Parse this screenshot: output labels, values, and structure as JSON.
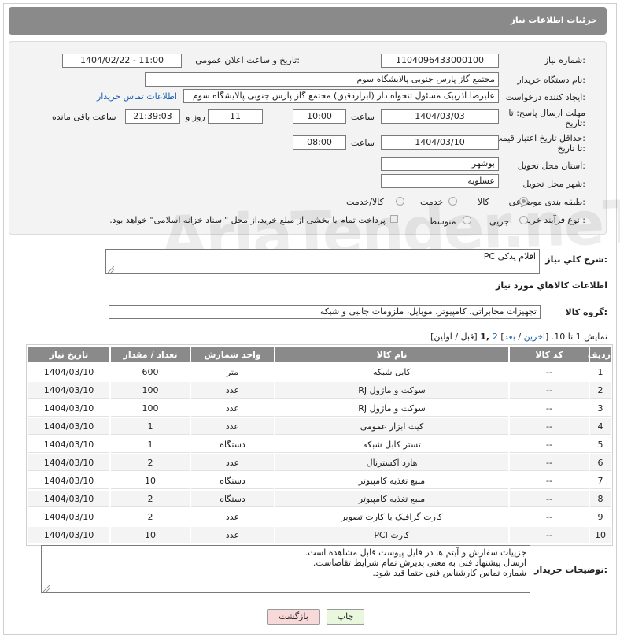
{
  "header": {
    "title": "جزئیات اطلاعات نیاز"
  },
  "watermark": "AriaTender.neT",
  "form": {
    "need_number_label": "شماره نیاز:",
    "need_number": "1104096433000100",
    "announce_label": "تاریخ و ساعت اعلان عمومی:",
    "announce_value": "1404/02/22 - 11:00",
    "buyer_org_label": "نام دستگاه خریدار:",
    "buyer_org": "مجتمع گاز پارس جنوبی  پالایشگاه سوم",
    "requester_label": "ایجاد کننده درخواست:",
    "requester": "علیرضا آذربیک مسئول تنخواه دار  (ابزاردقیق) مجتمع گاز پارس جنوبی  پالایشگاه سوم",
    "buyer_contact_link": "اطلاعات تماس خریدار",
    "deadline_label_1": "مهلت ارسال پاسخ: تا",
    "deadline_label_2": "تاریخ:",
    "deadline_date": "1404/03/03",
    "time_label": "ساعت",
    "deadline_time": "10:00",
    "days_value": "11",
    "days_label": "روز و",
    "remaining_time": "21:39:03",
    "remaining_label": "ساعت باقی مانده",
    "price_validity_label_1": "حداقل تاریخ اعتبار قیمت:",
    "price_validity_label_2": "تا تاریخ:",
    "price_validity_date": "1404/03/10",
    "price_validity_time": "08:00",
    "province_label": "استان محل تحویل:",
    "province": "بوشهر",
    "city_label": "شهر محل تحویل:",
    "city": "عسلویه",
    "category_label": "طبقه بندی موضوعی:",
    "category_options": [
      "کالا",
      "خدمت",
      "کالا/خدمت"
    ],
    "category_selected": "کالا",
    "process_label": "نوع فرآیند خرید :",
    "process_options": [
      "جزیی",
      "متوسط"
    ],
    "payment_note": "پرداخت تمام یا بخشی از مبلغ خرید،از محل \"اسناد خزانه اسلامی\" خواهد بود."
  },
  "summary": {
    "label": "شرح كلي نياز:",
    "value": "اقلام یدکی PC"
  },
  "goods_section": {
    "title": "اطلاعات كالاهاي مورد نياز",
    "group_label": "گروه كالا:",
    "group_value": "تجهیزات مخابراتی، کامپیوتر، موبایل، ملزومات جانبی و شبکه"
  },
  "pager": {
    "prefix": "نمایش 1 تا 10. [",
    "last": "آخرین",
    "sep1": " / ",
    "next": "بعد",
    "sep2": "] ",
    "page2": "2",
    "comma": " ,",
    "page1": "1",
    "suffix": " [قبل / اولین]"
  },
  "table": {
    "columns": [
      "ردیف",
      "کد کالا",
      "نام کالا",
      "واحد شمارش",
      "تعداد / مقدار",
      "تاریخ نیاز"
    ],
    "rows": [
      [
        "1",
        "--",
        "کابل شبکه",
        "متر",
        "600",
        "1404/03/10"
      ],
      [
        "2",
        "--",
        "سوکت و ماژول RJ",
        "عدد",
        "100",
        "1404/03/10"
      ],
      [
        "3",
        "--",
        "سوکت و ماژول RJ",
        "عدد",
        "100",
        "1404/03/10"
      ],
      [
        "4",
        "--",
        "کیت ابزار عمومی",
        "عدد",
        "1",
        "1404/03/10"
      ],
      [
        "5",
        "--",
        "تستر کابل شبکه",
        "دستگاه",
        "1",
        "1404/03/10"
      ],
      [
        "6",
        "--",
        "هارد اکسترنال",
        "عدد",
        "2",
        "1404/03/10"
      ],
      [
        "7",
        "--",
        "منبع تغذیه کامپیوتر",
        "دستگاه",
        "10",
        "1404/03/10"
      ],
      [
        "8",
        "--",
        "منبع تغذیه کامپیوتر",
        "دستگاه",
        "2",
        "1404/03/10"
      ],
      [
        "9",
        "--",
        "کارت گرافیک یا کارت تصویر",
        "عدد",
        "2",
        "1404/03/10"
      ],
      [
        "10",
        "--",
        "کارت PCI",
        "عدد",
        "10",
        "1404/03/10"
      ]
    ]
  },
  "buyer_notes": {
    "label": "توضیحات خریدار:",
    "lines": [
      "جزییات سفارش و آیتم ها در فایل پیوست قابل مشاهده است.",
      "ارسال پیشنهاد فنی به معنی پذیرش تمام شرایط تقاضاست.",
      "شماره تماس کارشناس فنی حتما قید شود."
    ]
  },
  "buttons": {
    "print": "چاپ",
    "back": "بازگشت"
  },
  "colors": {
    "header_bg": "#8a8a8a",
    "link": "#1a5fb4",
    "back_button_bg": "#f7d9d9",
    "print_button_bg": "#e9f7df"
  }
}
